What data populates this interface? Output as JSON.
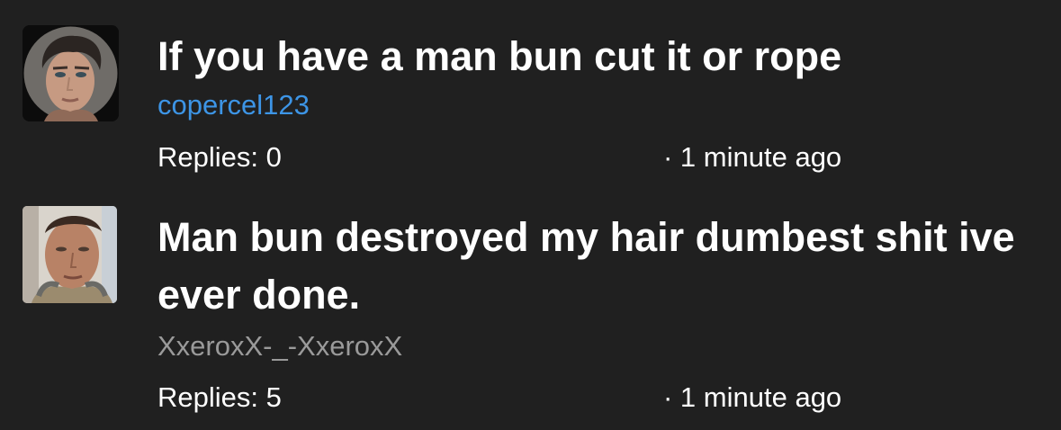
{
  "threads": [
    {
      "title": "If you have a man bun cut it or rope",
      "author": "copercel123",
      "author_color": "#3d95e6",
      "replies": "Replies: 0",
      "time": "· 1 minute ago",
      "avatar": "man-portrait-illustration"
    },
    {
      "title": "Man bun destroyed my hair dumbest shit ive ever done.",
      "author": "XxeroxX-_-XxeroxX",
      "author_color": "#9a9a9a",
      "replies": "Replies: 5",
      "time": "· 1 minute ago",
      "avatar": "man-photo"
    }
  ],
  "colors": {
    "background": "#202020",
    "text": "#ffffff"
  }
}
